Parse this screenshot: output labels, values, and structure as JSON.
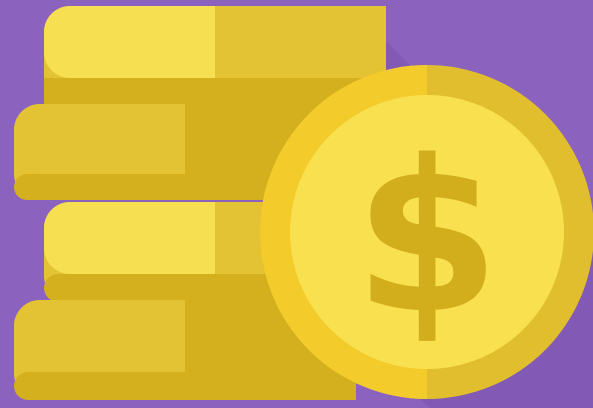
{
  "illustration": {
    "icon": "coin-stack-with-dollar-coin",
    "coin_symbol": "$",
    "colors": {
      "background": "#8C62BF",
      "background_shadow": "#7A52AC",
      "coin_highlight": "#F7DF52",
      "coin_mid": "#E3C233",
      "coin_shade": "#D4AF1E",
      "coin_dark": "#C89F16",
      "coin_outer_left": "#F3CB2A",
      "coin_outer_right": "#E1BE2E",
      "coin_face": "#F8E04F",
      "dollar_sign": "#D3AE1C"
    }
  }
}
